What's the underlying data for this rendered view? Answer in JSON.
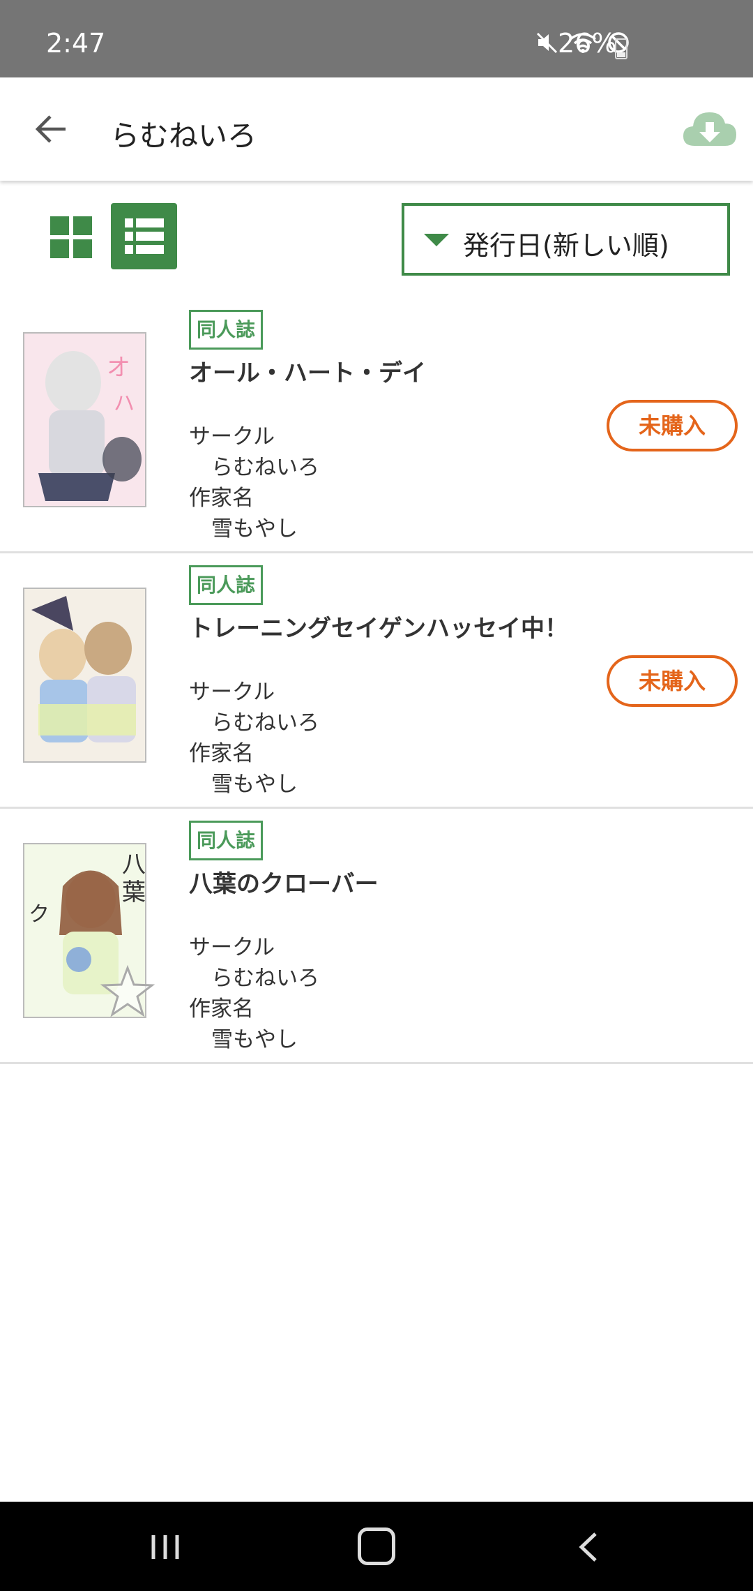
{
  "status_bar": {
    "time": "2:47",
    "battery": "26%"
  },
  "app_bar": {
    "title": "らむねいろ",
    "back_icon": "arrow-back-icon",
    "download_icon": "cloud-download-icon"
  },
  "toolbar": {
    "sort_label": "発行日(新しい順)",
    "grid_icon": "grid-view-icon",
    "list_icon": "list-view-icon"
  },
  "items": [
    {
      "badge": "同人誌",
      "title": "オール・ハート・デイ",
      "circle_label": "サークル",
      "circle": "らむねいろ",
      "author_label": "作家名",
      "author": "雪もやし",
      "status": "未購入"
    },
    {
      "badge": "同人誌",
      "title": "トレーニングセイゲンハッセイ中！",
      "circle_label": "サークル",
      "circle": "らむねいろ",
      "author_label": "作家名",
      "author": "雪もやし",
      "status": "未購入"
    },
    {
      "badge": "同人誌",
      "title": "八葉のクローバー",
      "circle_label": "サークル",
      "circle": "らむねいろ",
      "author_label": "作家名",
      "author": "雪もやし",
      "status": ""
    }
  ],
  "colors": {
    "accent_green": "#3f8a48",
    "unpurchased_orange": "#e4651b",
    "status_bar": "#757575"
  }
}
